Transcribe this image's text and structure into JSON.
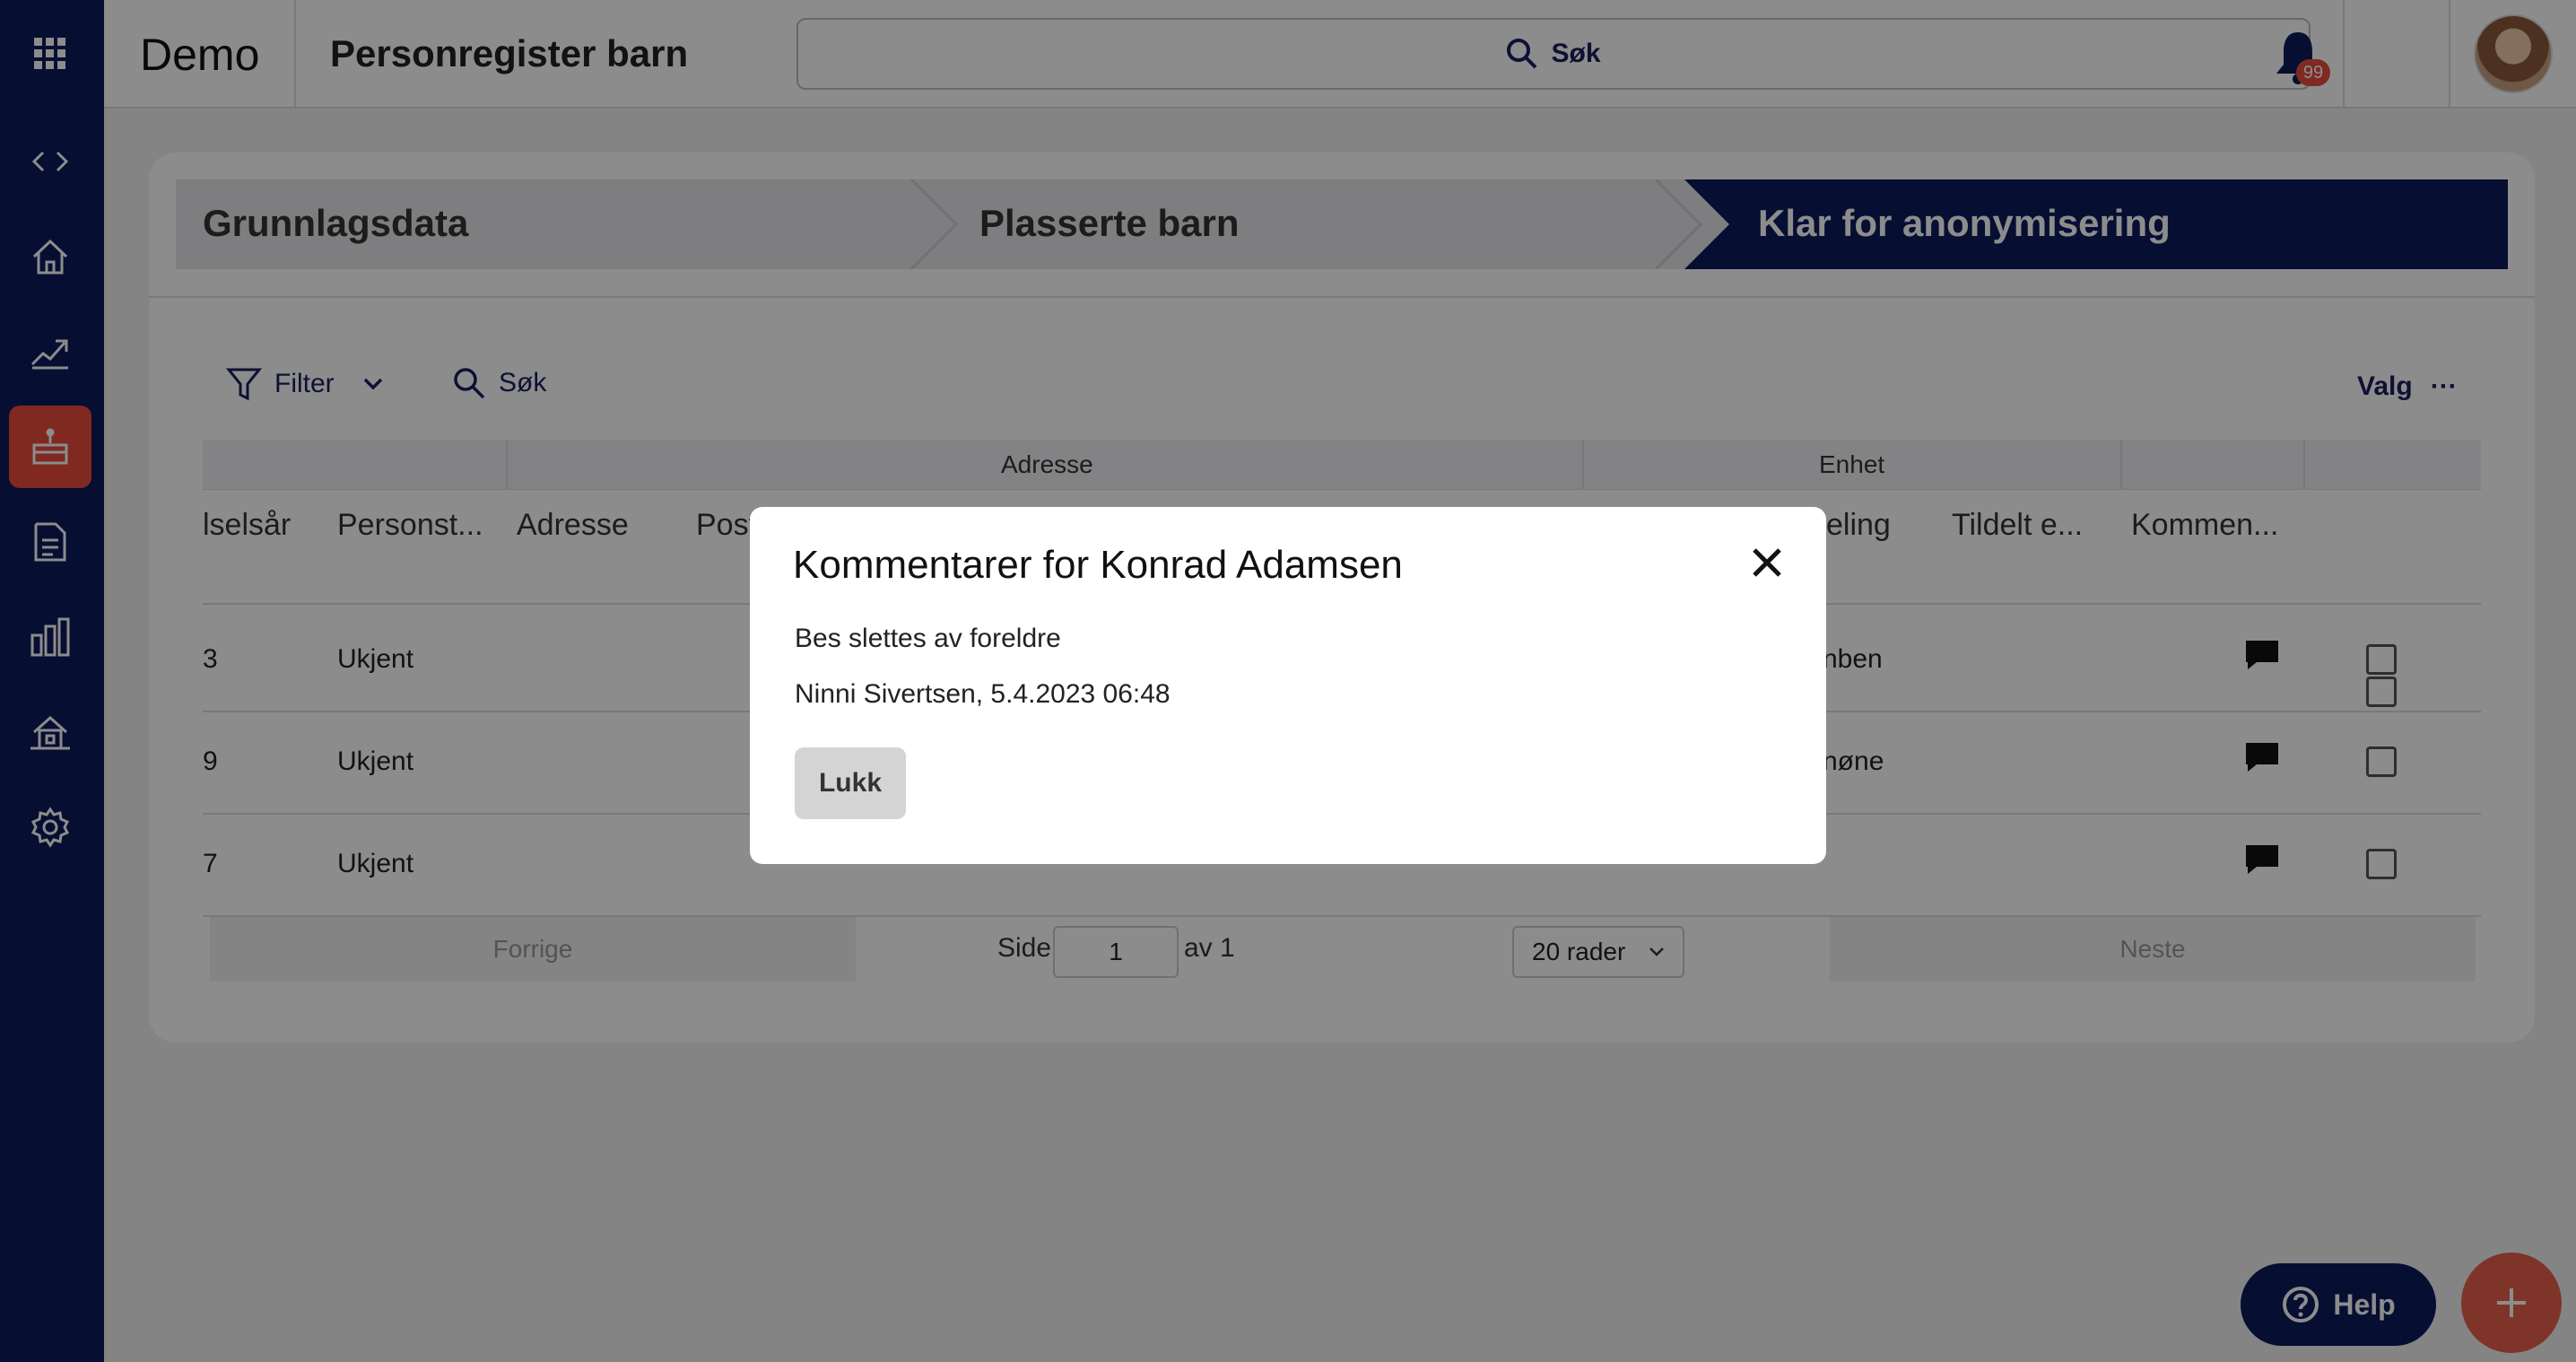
{
  "brand": "Demo",
  "app_title": "Personregister barn",
  "global_search": {
    "label": "Søk"
  },
  "notifications": {
    "count": "99"
  },
  "steps": [
    {
      "label": "Grunnlagsdata",
      "active": false
    },
    {
      "label": "Plasserte barn",
      "active": false
    },
    {
      "label": "Klar for anonymisering",
      "active": true
    }
  ],
  "toolbar": {
    "filter_label": "Filter",
    "search_label": "Søk",
    "valg_label": "Valg",
    "more_label": "···"
  },
  "table": {
    "groups": [
      "Adresse",
      "Enhet"
    ],
    "columns": [
      "lselsår",
      "Personst...",
      "Adresse",
      "Post",
      "eling",
      "Tildelt e...",
      "Kommen..."
    ],
    "rows": [
      {
        "year": "3",
        "status": "Ukjent",
        "unit": "nben"
      },
      {
        "year": "9",
        "status": "Ukjent",
        "unit": "nøne"
      },
      {
        "year": "7",
        "status": "Ukjent",
        "unit": ""
      }
    ]
  },
  "pager": {
    "prev": "Forrige",
    "side": "Side",
    "page": "1",
    "of": "av 1",
    "rows": "20 rader",
    "next": "Neste"
  },
  "help_label": "Help",
  "modal": {
    "title": "Kommentarer for Konrad Adamsen",
    "comment": "Bes slettes av foreldre",
    "meta": "Ninni Sivertsen, 5.4.2023 06:48",
    "close_label": "Lukk"
  },
  "colors": {
    "navy": "#0b1a5c",
    "accent": "#e74c3c"
  }
}
